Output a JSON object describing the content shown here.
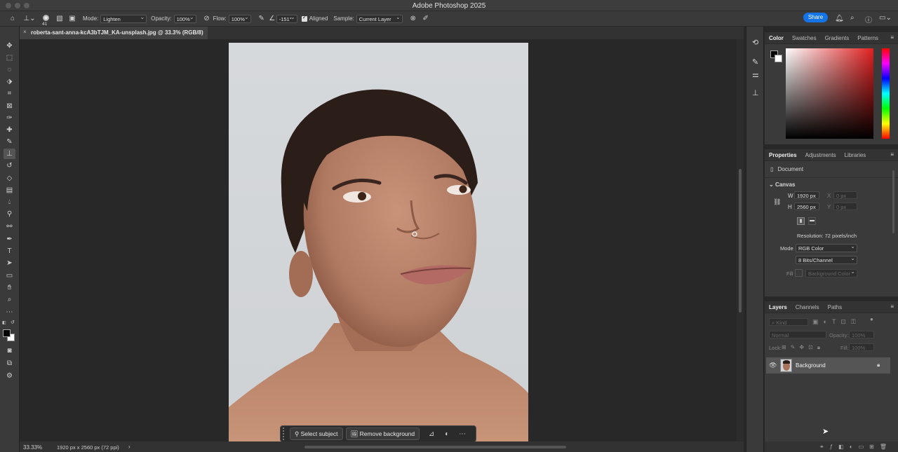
{
  "window": {
    "title": "Adobe Photoshop 2025"
  },
  "options_bar": {
    "brush_size": "41",
    "mode_label": "Mode:",
    "mode_value": "Lighten",
    "opacity_label": "Opacity:",
    "opacity_value": "100%",
    "flow_label": "Flow:",
    "flow_value": "100%",
    "angle_value": "-151°",
    "aligned_label": "Aligned",
    "sample_label": "Sample:",
    "sample_value": "Current Layer",
    "share_label": "Share"
  },
  "document_tab": {
    "label": "roberta-sant-anna-kcA3bTJM_KA-unsplash.jpg @ 33.3% (RGB/8)"
  },
  "status_bar": {
    "zoom": "33.33%",
    "doc_info": "1920 px x 2560 px (72 ppi)"
  },
  "context_bar": {
    "select_subject": "Select subject",
    "remove_background": "Remove background"
  },
  "color_panel": {
    "tabs": [
      "Color",
      "Swatches",
      "Gradients",
      "Patterns"
    ],
    "hue_color": "#e02020"
  },
  "properties_panel": {
    "tabs": [
      "Properties",
      "Adjustments",
      "Libraries"
    ],
    "document_label": "Document",
    "canvas_label": "Canvas",
    "w_label": "W",
    "w_value": "1920 px",
    "h_label": "H",
    "h_value": "2560 px",
    "x_label": "X",
    "x_placeholder": "0 px",
    "y_label": "Y",
    "y_placeholder": "0 px",
    "resolution": "Resolution: 72 pixels/inch",
    "mode_label": "Mode",
    "mode_value": "RGB Color",
    "bits_value": "8 Bits/Channel",
    "fill_label": "Fill",
    "fill_value": "Background Color"
  },
  "layers_panel": {
    "tabs": [
      "Layers",
      "Channels",
      "Paths"
    ],
    "kind_placeholder": "Kind",
    "blend_mode": "Normal",
    "opacity_label": "Opacity:",
    "opacity_value": "100%",
    "lock_label": "Lock:",
    "fill_label": "Fill:",
    "fill_value": "100%",
    "layers": [
      {
        "name": "Background",
        "visible": true,
        "locked": true
      }
    ]
  }
}
